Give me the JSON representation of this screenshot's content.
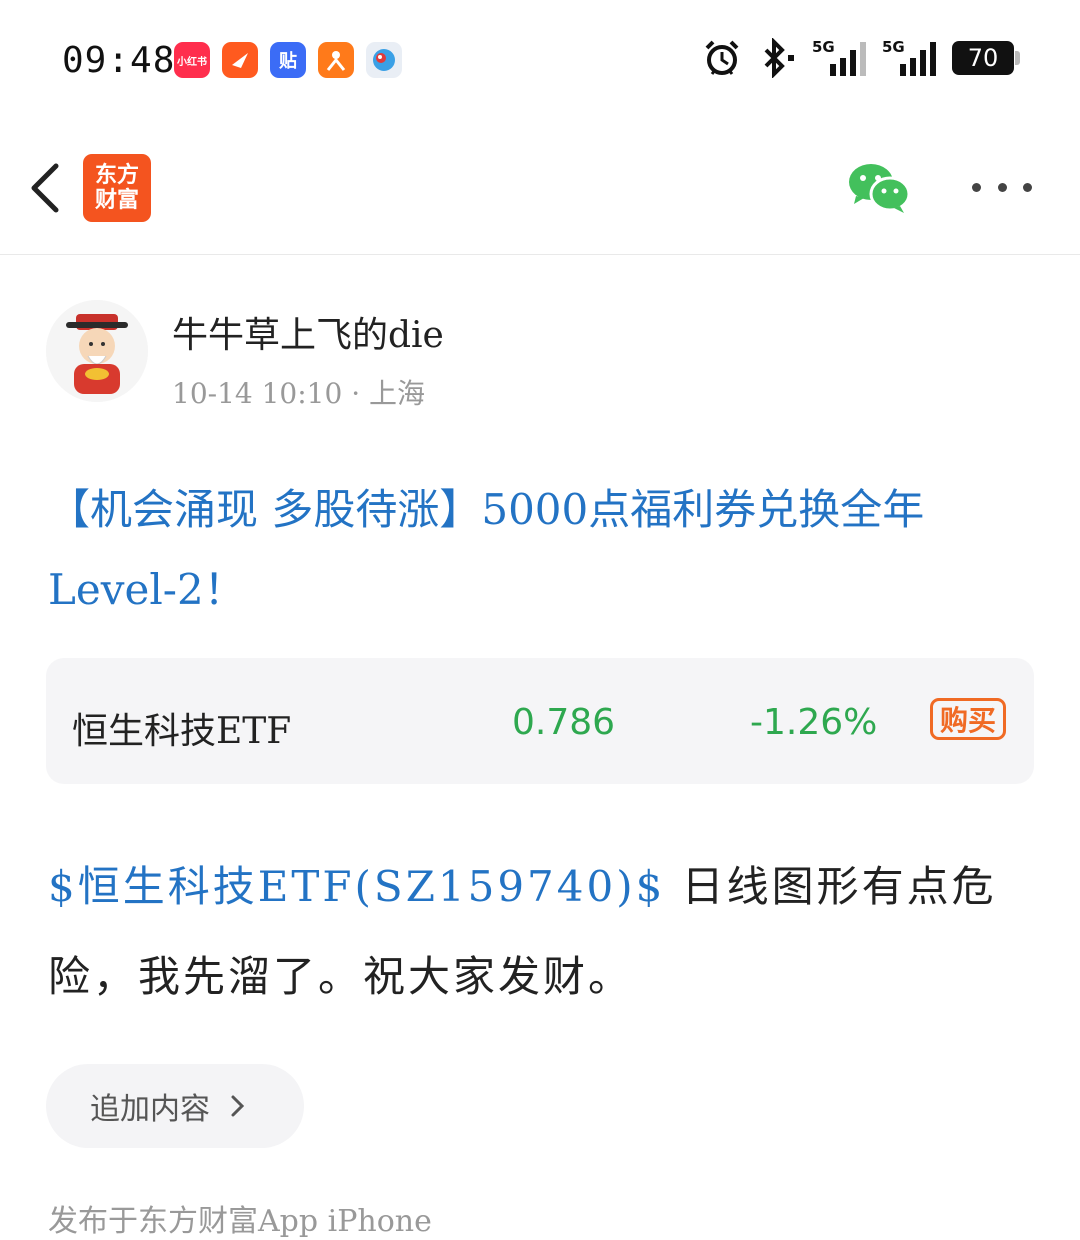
{
  "status_bar": {
    "time": "09:48",
    "app_icons": [
      {
        "name": "xiaohongshu-app-icon",
        "label": "小红书",
        "color": "#ff2e4d"
      },
      {
        "name": "feishu-app-icon",
        "label": "",
        "color": "#ff5a1f"
      },
      {
        "name": "tieba-app-icon",
        "label": "贴",
        "color": "#3b6cf6"
      },
      {
        "name": "dianping-app-icon",
        "label": "",
        "color": "#ff7a1a"
      },
      {
        "name": "bird-app-icon",
        "label": "",
        "color": "#e9eef5"
      }
    ],
    "signal1_tag": "5G",
    "signal2_tag": "5G",
    "battery": "70"
  },
  "nav": {
    "logo_line1": "东方",
    "logo_line2": "财富"
  },
  "author": {
    "name": "牛牛草上飞的die",
    "meta": "10-14 10:10 · 上海"
  },
  "promo_title": "【机会涌现 多股待涨】5000点福利券兑换全年Level-2！",
  "stock_card": {
    "name": "恒生科技ETF",
    "price": "0.786",
    "change": "-1.26%",
    "buy_label": "购买"
  },
  "post": {
    "stock_link": "$恒生科技ETF(SZ159740)$",
    "text": " 日线图形有点危险，我先溜了。祝大家发财。"
  },
  "append_button": "追加内容",
  "footer_partial": "发布于东方财富App iPhone"
}
